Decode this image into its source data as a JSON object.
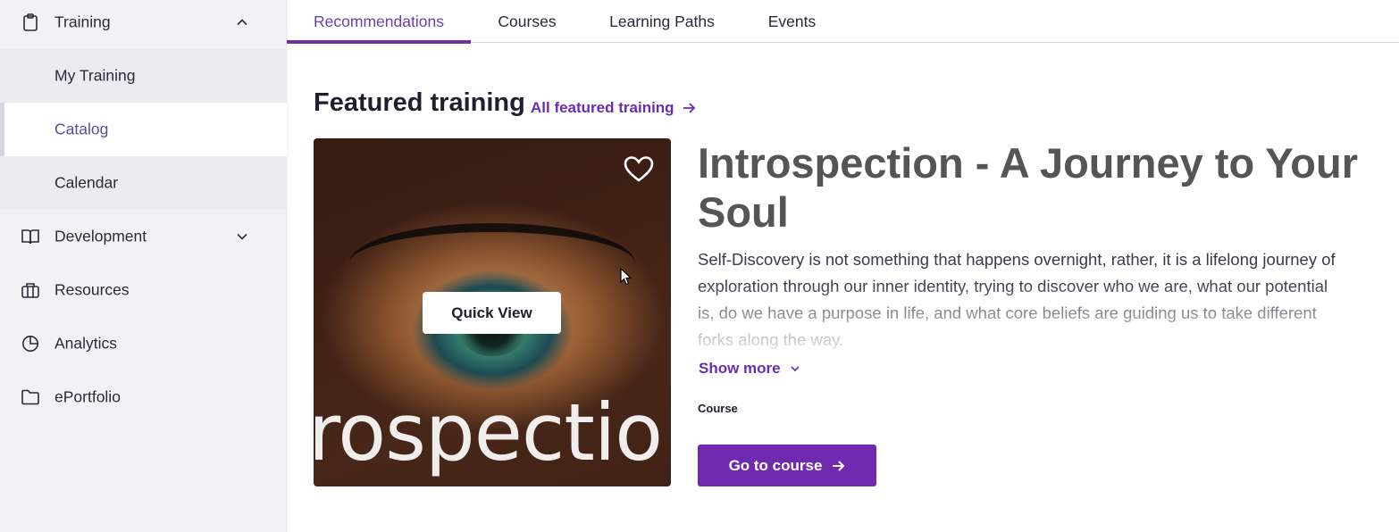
{
  "sidebar": {
    "training": {
      "label": "Training",
      "icon": "clipboard-icon",
      "expanded": true
    },
    "sub_items": [
      {
        "label": "My Training",
        "active": false
      },
      {
        "label": "Catalog",
        "active": true
      },
      {
        "label": "Calendar",
        "active": false
      }
    ],
    "items": [
      {
        "label": "Development",
        "icon": "book-icon"
      },
      {
        "label": "Resources",
        "icon": "briefcase-icon"
      },
      {
        "label": "Analytics",
        "icon": "pie-chart-icon"
      },
      {
        "label": "ePortfolio",
        "icon": "folder-icon"
      }
    ]
  },
  "tabs": [
    {
      "label": "Recommendations",
      "active": true
    },
    {
      "label": "Courses",
      "active": false
    },
    {
      "label": "Learning Paths",
      "active": false
    },
    {
      "label": "Events",
      "active": false
    }
  ],
  "featured": {
    "title": "Featured training",
    "all_link": "All featured training",
    "image_word": "rospectio",
    "quick_view": "Quick View",
    "course_title": "Introspection - A Journey to Your Soul",
    "description": "Self-Discovery is not something that happens overnight, rather, it is a lifelong journey of exploration through our inner identity, trying to discover who we are, what our potential is, do we have a purpose in life, and what core beliefs are guiding us to take different forks along the way.",
    "show_more": "Show more",
    "type": "Course",
    "cta": "Go to course"
  },
  "colors": {
    "accent": "#6f2ab0",
    "link": "#6a2db0",
    "sidebar_bg": "#f2f2f6"
  }
}
